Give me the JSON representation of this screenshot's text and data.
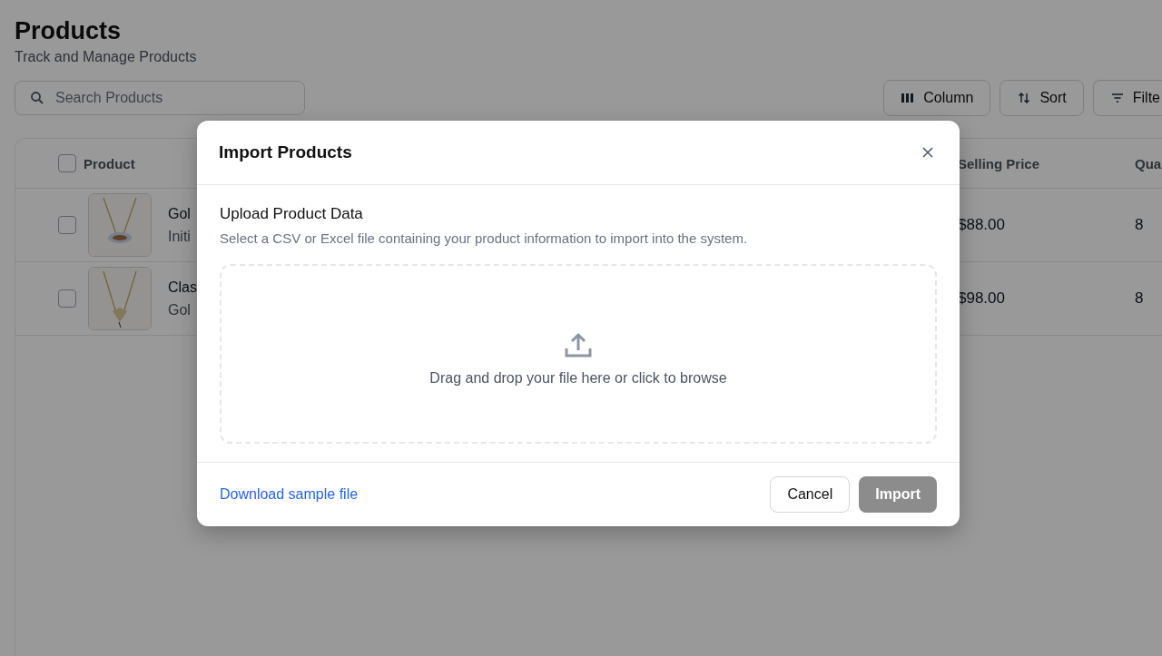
{
  "page": {
    "title": "Products",
    "subtitle": "Track and Manage Products"
  },
  "search": {
    "placeholder": "Search Products"
  },
  "toolbar_buttons": [
    {
      "kind": "column",
      "label": "Column"
    },
    {
      "kind": "sort",
      "label": "Sort"
    },
    {
      "kind": "filter",
      "label": "Filte"
    }
  ],
  "table": {
    "select_all": {
      "checked": false
    },
    "columns": [
      "Product",
      "Selling Price",
      "Qua"
    ],
    "rows": [
      {
        "checked": false,
        "name": "Gol",
        "subtitle": "Initi",
        "selling_price": "$88.00",
        "quantity": "8"
      },
      {
        "checked": false,
        "name": "Clas",
        "subtitle": "Gol",
        "selling_price": "$98.00",
        "quantity": "8"
      }
    ]
  },
  "dialog": {
    "title": "Import Products",
    "heading": "Upload Product Data",
    "description": "Select a CSV or Excel file containing your product information to import into the system.",
    "dropzone_text": "Drag and drop your file here or click to browse",
    "link": "Download sample file",
    "buttons": [
      {
        "kind": "secondary",
        "label": "Cancel",
        "disabled": false
      },
      {
        "kind": "primary",
        "label": "Import",
        "disabled": true
      }
    ]
  }
}
